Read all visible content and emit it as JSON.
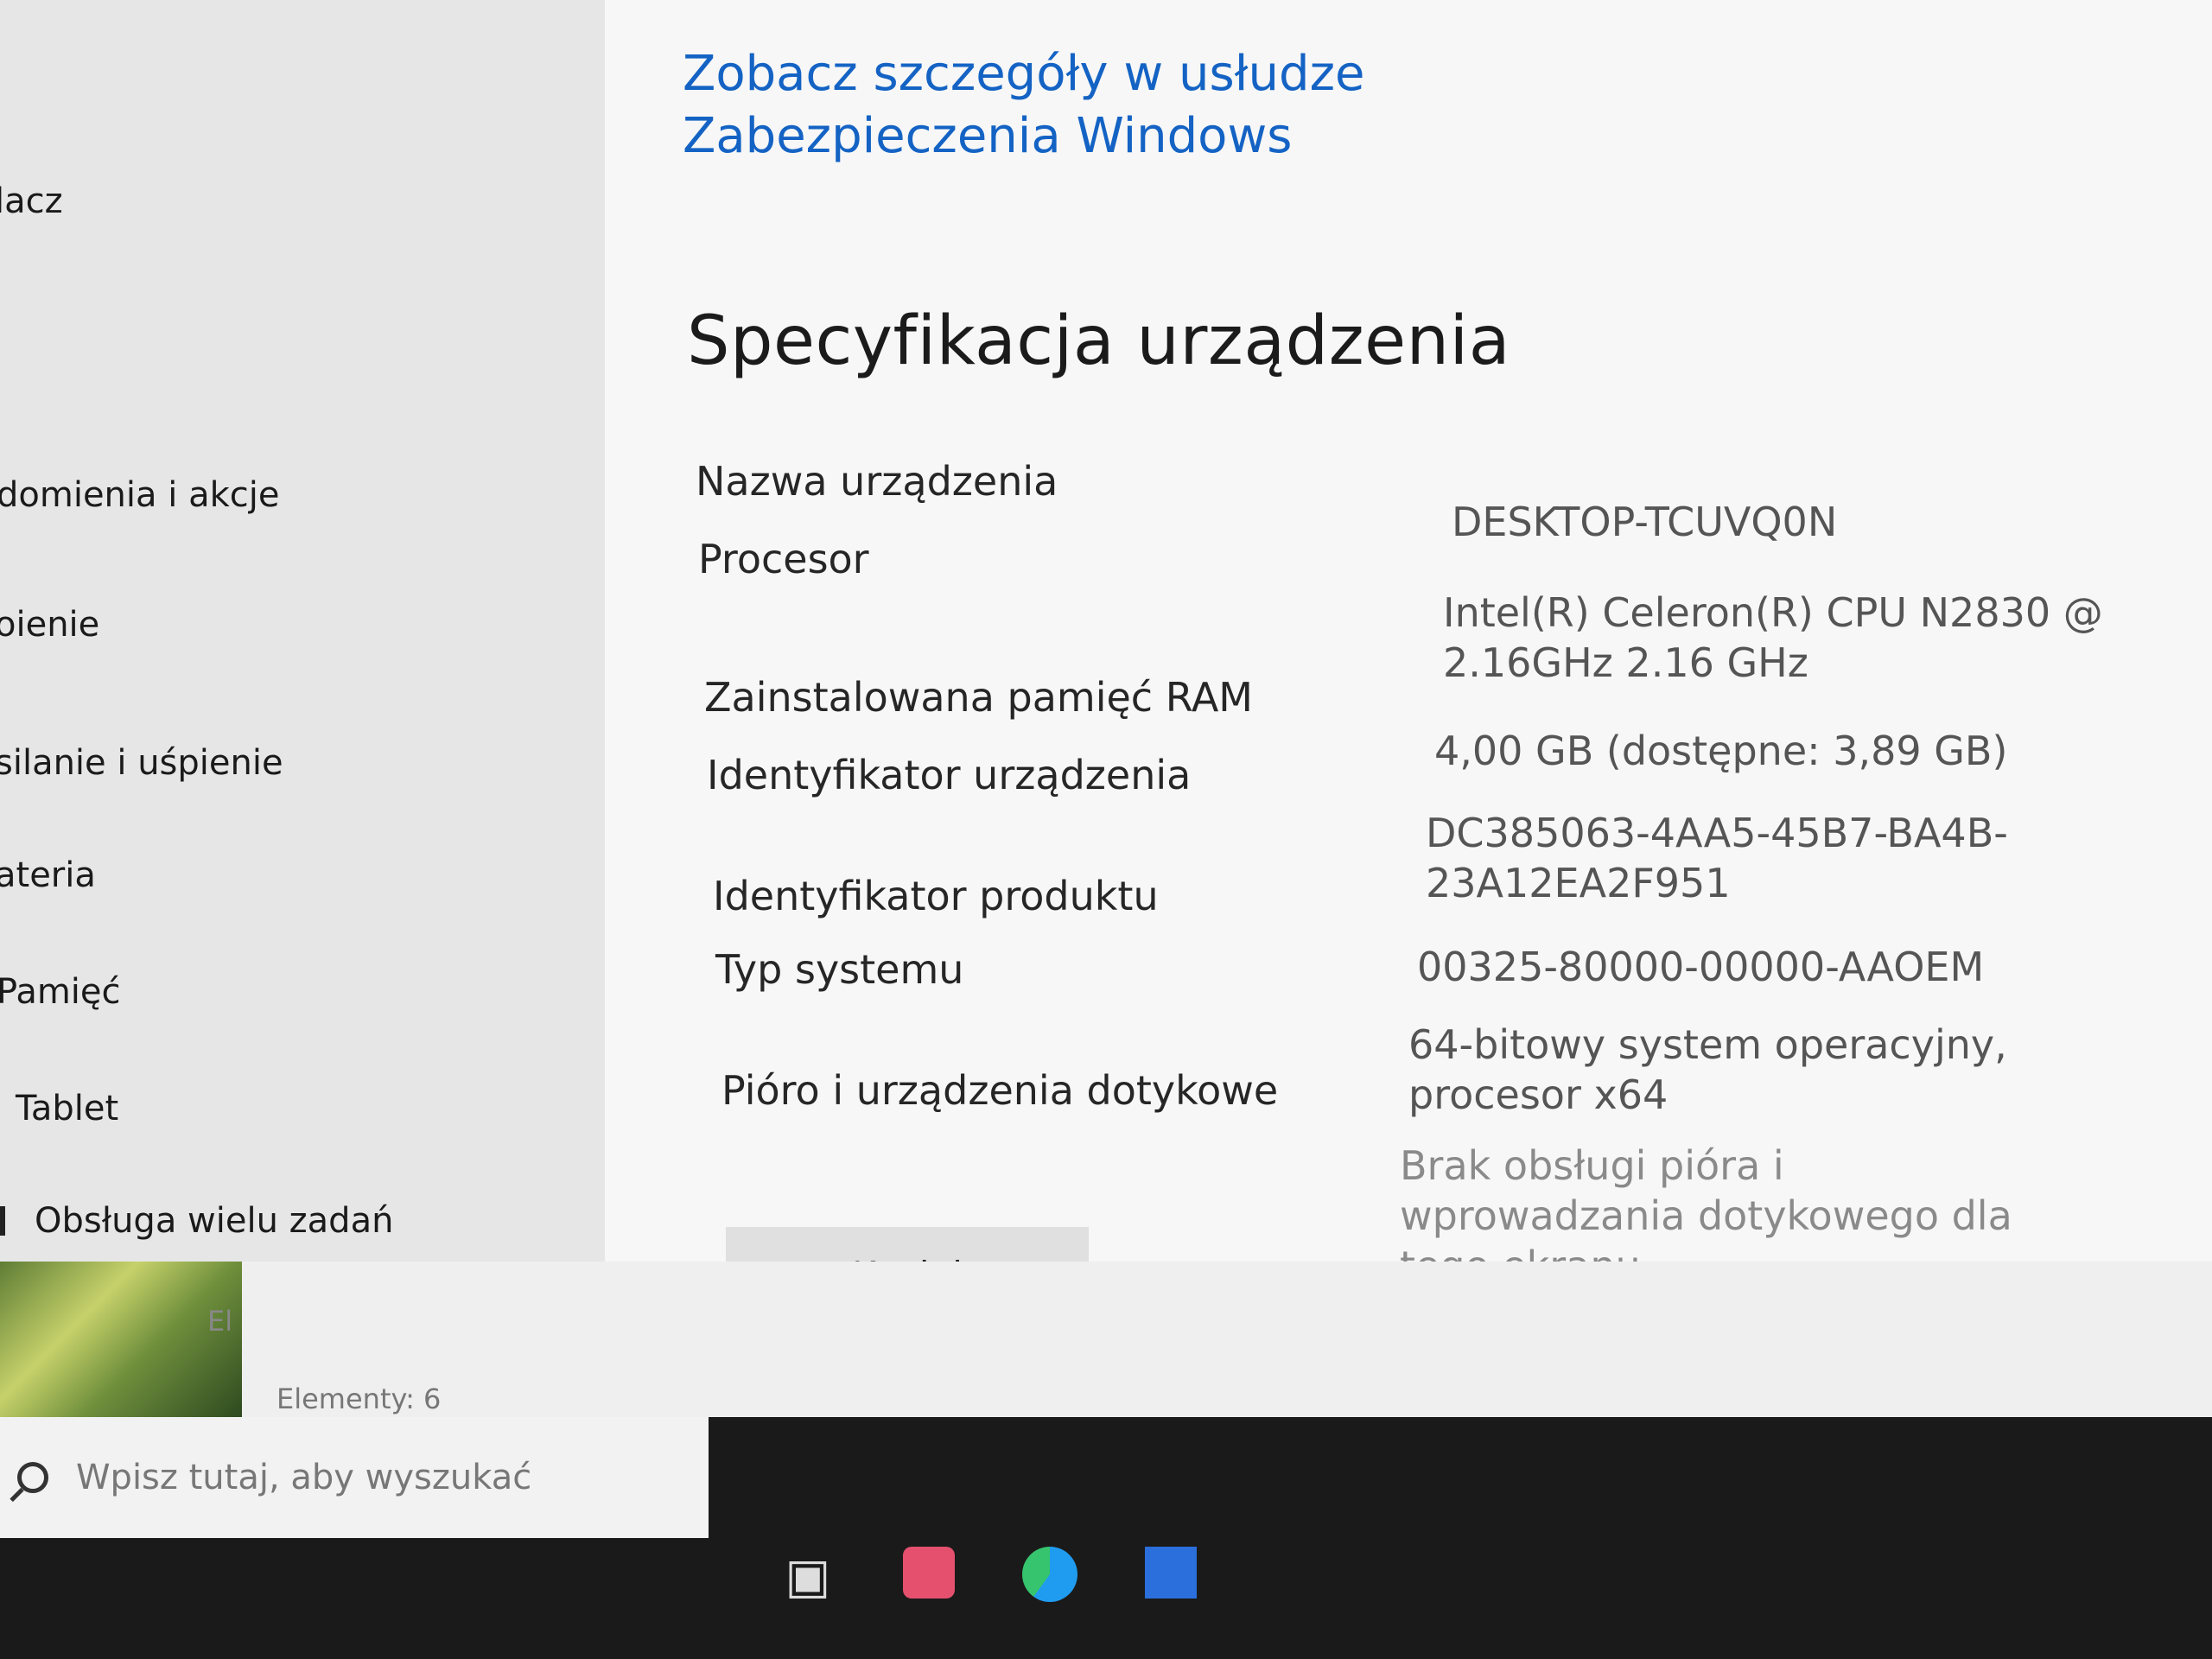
{
  "sidebar": {
    "items": [
      {
        "label": "lacz",
        "icon": "monitor-icon"
      },
      {
        "label": "domienia i akcje",
        "icon": "notification-icon"
      },
      {
        "label": "oienie",
        "icon": "focus-icon"
      },
      {
        "label": "silanie i uśpienie",
        "icon": "power-icon"
      },
      {
        "label": "ateria",
        "icon": "battery-icon"
      },
      {
        "label": "Pamięć",
        "icon": "storage-icon"
      },
      {
        "label": "Tablet",
        "icon": "tablet-icon"
      },
      {
        "label": "Obsługa wielu zadań",
        "icon": "multitasking-icon"
      }
    ]
  },
  "main": {
    "security_link": "Zobacz szczegóły w usłudze Zabezpieczenia Windows",
    "section_title": "Specyfikacja urządzenia",
    "specs": [
      {
        "label": "Nazwa urządzenia",
        "value": "DESKTOP-TCUVQ0N"
      },
      {
        "label": "Procesor",
        "value": "Intel(R) Celeron(R) CPU  N2830 @ 2.16GHz   2.16 GHz"
      },
      {
        "label": "Zainstalowana pamięć RAM",
        "value": "4,00 GB (dostępne: 3,89 GB)"
      },
      {
        "label": "Identyfikator urządzenia",
        "value": "DC385063-4AA5-45B7-BA4B-23A12EA2F951"
      },
      {
        "label": "Identyfikator produktu",
        "value": "00325-80000-00000-AAOEM"
      },
      {
        "label": "Typ systemu",
        "value": "64-bitowy system operacyjny, procesor x64"
      },
      {
        "label": "Pióro i urządzenia dotykowe",
        "value": "Brak obsługi pióra i wprowadzania dotykowego dla tego ekranu"
      }
    ],
    "copy_label": "Kopiuj"
  },
  "explorer": {
    "thumb_label": "El",
    "items_count": "Elementy: 6"
  },
  "taskbar": {
    "search_placeholder": "Wpisz tutaj, aby wyszukać",
    "icons": [
      "task-view-icon",
      "photoshop-icon",
      "edge-icon",
      "store-icon"
    ]
  }
}
